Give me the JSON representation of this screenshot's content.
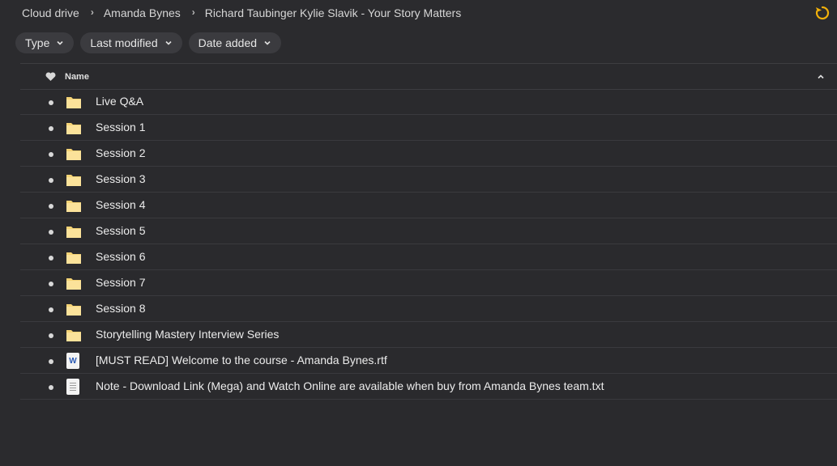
{
  "breadcrumb": {
    "items": [
      "Cloud drive",
      "Amanda Bynes",
      "Richard Taubinger Kylie Slavik - Your Story Matters"
    ]
  },
  "filters": {
    "type_label": "Type",
    "modified_label": "Last modified",
    "added_label": "Date added"
  },
  "table": {
    "name_header": "Name",
    "rows": [
      {
        "name": "Live Q&A",
        "icon": "folder-icon"
      },
      {
        "name": "Session 1",
        "icon": "folder-icon"
      },
      {
        "name": "Session 2",
        "icon": "folder-icon"
      },
      {
        "name": "Session 3",
        "icon": "folder-icon"
      },
      {
        "name": "Session 4",
        "icon": "folder-icon"
      },
      {
        "name": "Session 5",
        "icon": "folder-icon"
      },
      {
        "name": "Session 6",
        "icon": "folder-icon"
      },
      {
        "name": "Session 7",
        "icon": "folder-icon"
      },
      {
        "name": "Session 8",
        "icon": "folder-icon"
      },
      {
        "name": "Storytelling Mastery Interview Series",
        "icon": "folder-icon"
      },
      {
        "name": "[MUST READ] Welcome to the course - Amanda Bynes.rtf",
        "icon": "word-doc-icon"
      },
      {
        "name": "Note - Download Link (Mega) and Watch Online are available when buy from Amanda Bynes team.txt",
        "icon": "text-file-icon"
      }
    ]
  },
  "colors": {
    "background": "#2b2b2e",
    "folder": "#f5d375",
    "reload_accent": "#f2b10a"
  }
}
